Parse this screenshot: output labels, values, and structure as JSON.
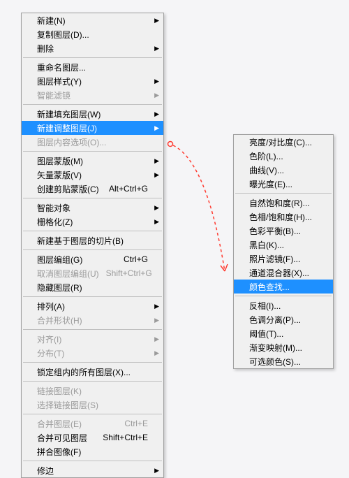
{
  "menu_left": {
    "groups": [
      [
        {
          "label": "新建(N)",
          "submenu": true
        },
        {
          "label": "复制图层(D)..."
        },
        {
          "label": "删除",
          "submenu": true
        }
      ],
      [
        {
          "label": "重命名图层..."
        },
        {
          "label": "图层样式(Y)",
          "submenu": true
        },
        {
          "label": "智能滤镜",
          "submenu": true,
          "disabled": true
        }
      ],
      [
        {
          "label": "新建填充图层(W)",
          "submenu": true
        },
        {
          "label": "新建调整图层(J)",
          "submenu": true,
          "highlighted": true
        },
        {
          "label": "图层内容选项(O)...",
          "disabled": true
        }
      ],
      [
        {
          "label": "图层蒙版(M)",
          "submenu": true
        },
        {
          "label": "矢量蒙版(V)",
          "submenu": true
        },
        {
          "label": "创建剪贴蒙版(C)",
          "shortcut": "Alt+Ctrl+G"
        }
      ],
      [
        {
          "label": "智能对象",
          "submenu": true
        },
        {
          "label": "栅格化(Z)",
          "submenu": true
        }
      ],
      [
        {
          "label": "新建基于图层的切片(B)"
        }
      ],
      [
        {
          "label": "图层编组(G)",
          "shortcut": "Ctrl+G"
        },
        {
          "label": "取消图层编组(U)",
          "shortcut": "Shift+Ctrl+G",
          "disabled": true
        },
        {
          "label": "隐藏图层(R)"
        }
      ],
      [
        {
          "label": "排列(A)",
          "submenu": true
        },
        {
          "label": "合并形状(H)",
          "submenu": true,
          "disabled": true
        }
      ],
      [
        {
          "label": "对齐(I)",
          "submenu": true,
          "disabled": true
        },
        {
          "label": "分布(T)",
          "submenu": true,
          "disabled": true
        }
      ],
      [
        {
          "label": "锁定组内的所有图层(X)..."
        }
      ],
      [
        {
          "label": "链接图层(K)",
          "disabled": true
        },
        {
          "label": "选择链接图层(S)",
          "disabled": true
        }
      ],
      [
        {
          "label": "合并图层(E)",
          "shortcut": "Ctrl+E",
          "disabled": true
        },
        {
          "label": "合并可见图层",
          "shortcut": "Shift+Ctrl+E"
        },
        {
          "label": "拼合图像(F)"
        }
      ],
      [
        {
          "label": "修边",
          "submenu": true
        }
      ]
    ]
  },
  "menu_right": {
    "groups": [
      [
        {
          "label": "亮度/对比度(C)..."
        },
        {
          "label": "色阶(L)..."
        },
        {
          "label": "曲线(V)..."
        },
        {
          "label": "曝光度(E)..."
        }
      ],
      [
        {
          "label": "自然饱和度(R)..."
        },
        {
          "label": "色相/饱和度(H)..."
        },
        {
          "label": "色彩平衡(B)..."
        },
        {
          "label": "黑白(K)..."
        },
        {
          "label": "照片滤镜(F)..."
        },
        {
          "label": "通道混合器(X)..."
        },
        {
          "label": "颜色查找...",
          "highlighted": true
        }
      ],
      [
        {
          "label": "反相(I)..."
        },
        {
          "label": "色调分离(P)..."
        },
        {
          "label": "阈值(T)..."
        },
        {
          "label": "渐变映射(M)..."
        },
        {
          "label": "可选颜色(S)..."
        }
      ]
    ]
  },
  "annotation": {
    "stroke": "#ff3b30",
    "dash": "4 4"
  }
}
